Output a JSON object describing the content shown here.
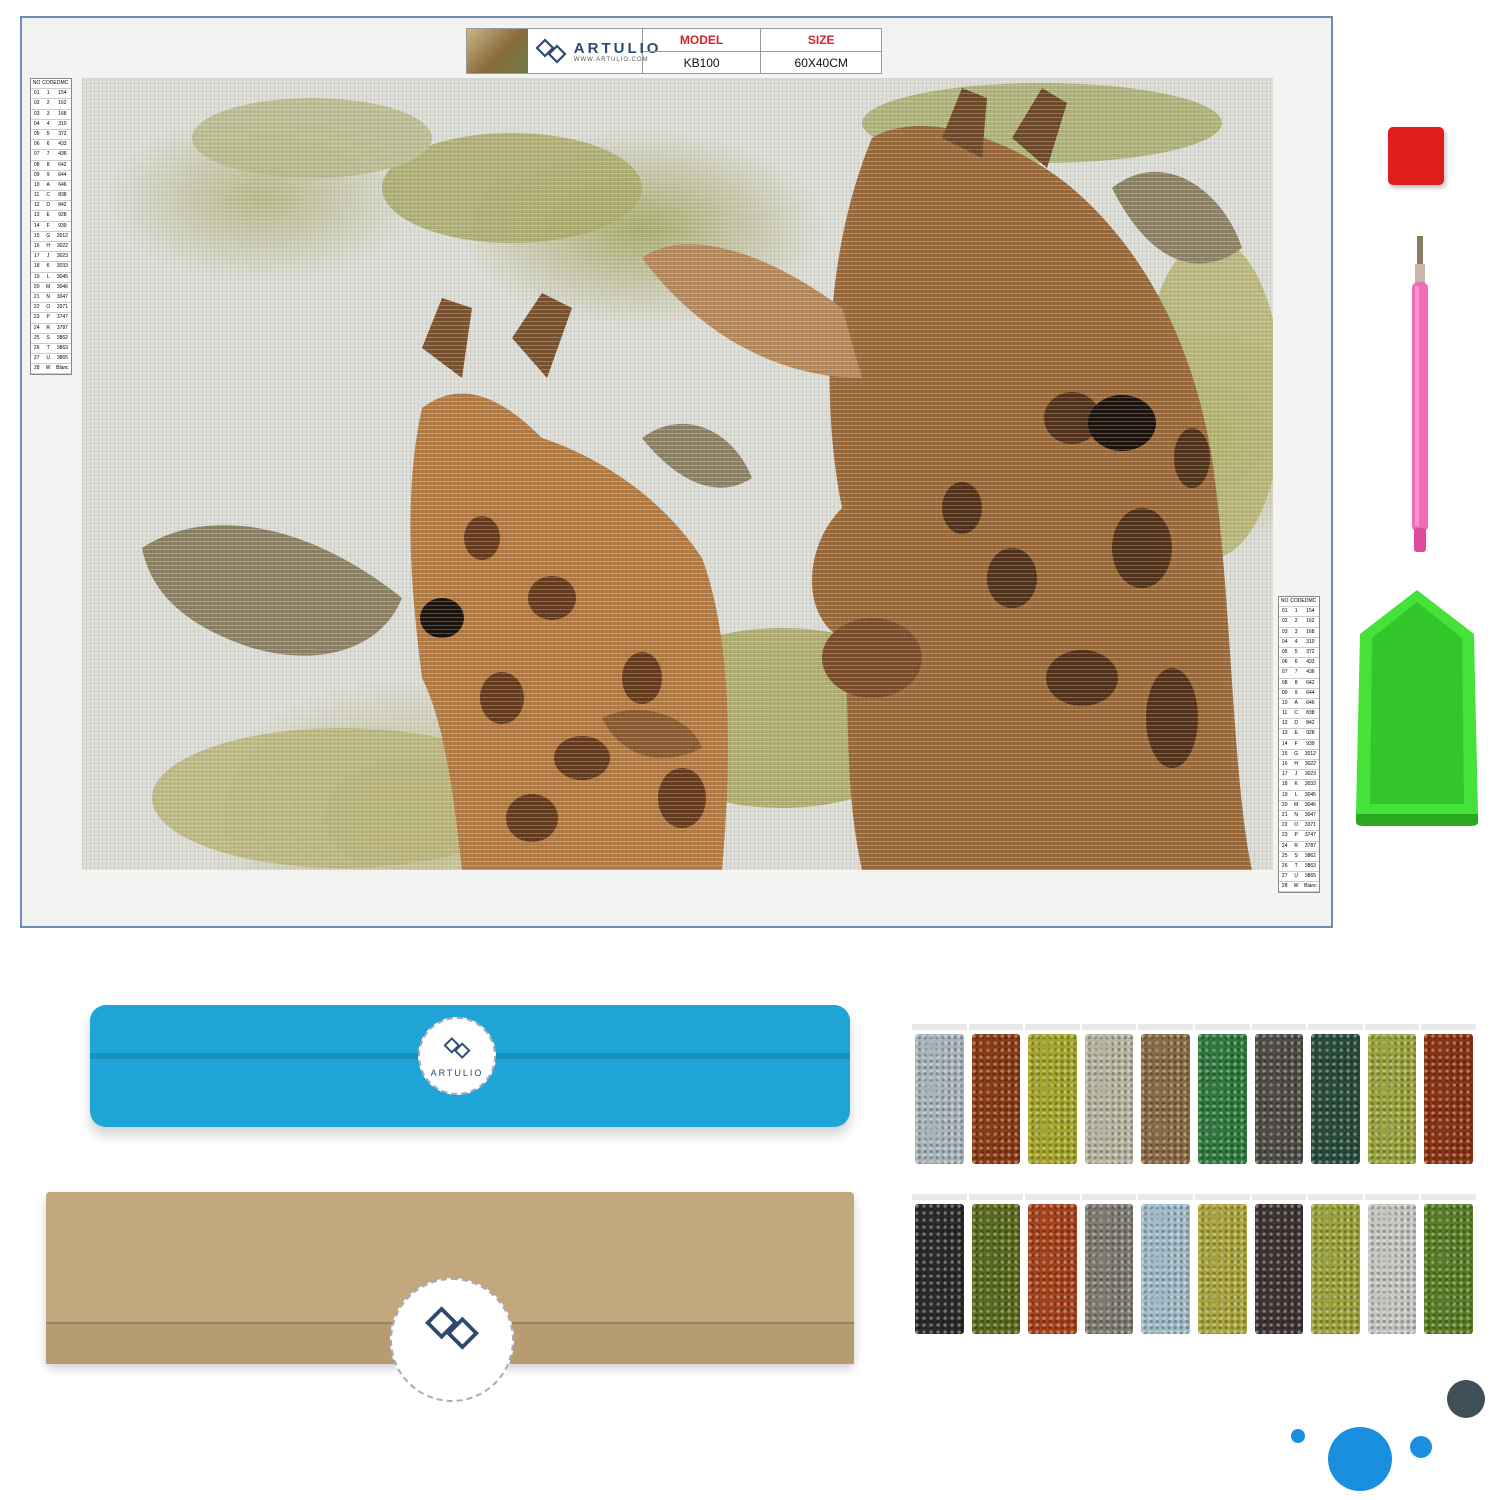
{
  "header": {
    "brand": "ARTULIO",
    "url": "WWW.ARTULIO.COM",
    "model_label": "MODEL",
    "model_value": "KB100",
    "size_label": "SIZE",
    "size_value": "60X40CM"
  },
  "legend": {
    "headers": [
      "NO",
      "CODE",
      "DMC"
    ],
    "rows": [
      [
        "01",
        "1",
        "154"
      ],
      [
        "02",
        "2",
        "162"
      ],
      [
        "03",
        "3",
        "168"
      ],
      [
        "04",
        "4",
        "310"
      ],
      [
        "05",
        "5",
        "372"
      ],
      [
        "06",
        "6",
        "433"
      ],
      [
        "07",
        "7",
        "436"
      ],
      [
        "08",
        "8",
        "642"
      ],
      [
        "09",
        "9",
        "644"
      ],
      [
        "10",
        "A",
        "646"
      ],
      [
        "11",
        "C",
        "838"
      ],
      [
        "12",
        "D",
        "842"
      ],
      [
        "13",
        "E",
        "928"
      ],
      [
        "14",
        "F",
        "939"
      ],
      [
        "15",
        "G",
        "3012"
      ],
      [
        "16",
        "H",
        "3022"
      ],
      [
        "17",
        "J",
        "3023"
      ],
      [
        "18",
        "K",
        "3033"
      ],
      [
        "19",
        "L",
        "3045"
      ],
      [
        "20",
        "M",
        "3046"
      ],
      [
        "21",
        "N",
        "3047"
      ],
      [
        "22",
        "O",
        "3371"
      ],
      [
        "23",
        "P",
        "3747"
      ],
      [
        "24",
        "R",
        "3787"
      ],
      [
        "25",
        "S",
        "3862"
      ],
      [
        "26",
        "T",
        "3863"
      ],
      [
        "27",
        "U",
        "3865"
      ],
      [
        "28",
        "W",
        "Blanc"
      ]
    ]
  },
  "tube_seal": {
    "brand": "ARTULIO"
  },
  "colors": {
    "accent_red": "#d0242a",
    "brand_blue": "#2b4a6f",
    "tube_blue": "#1ea4d7",
    "wax_red": "#e01c1c",
    "pen_pink": "#f06cb4",
    "tray_green": "#45e23a",
    "box_kraft": "#c2a77f"
  },
  "bag_colors": {
    "row1": [
      "#a9b5bd",
      "#8a3b12",
      "#a5a52a",
      "#b9b4a0",
      "#8a6a43",
      "#2f7a3e",
      "#4e4c44",
      "#284c3c",
      "#9aa33c",
      "#8a3312"
    ],
    "row2": [
      "#2a2a2a",
      "#5a6a1c",
      "#a6411a",
      "#7d7b70",
      "#9fbcc8",
      "#a9a53c",
      "#3d3431",
      "#9aa238",
      "#c6c6c1",
      "#587d24"
    ]
  },
  "icons": {
    "logo": "artulio-diamond-logo-icon",
    "decor": "blue-dots-decoration"
  }
}
